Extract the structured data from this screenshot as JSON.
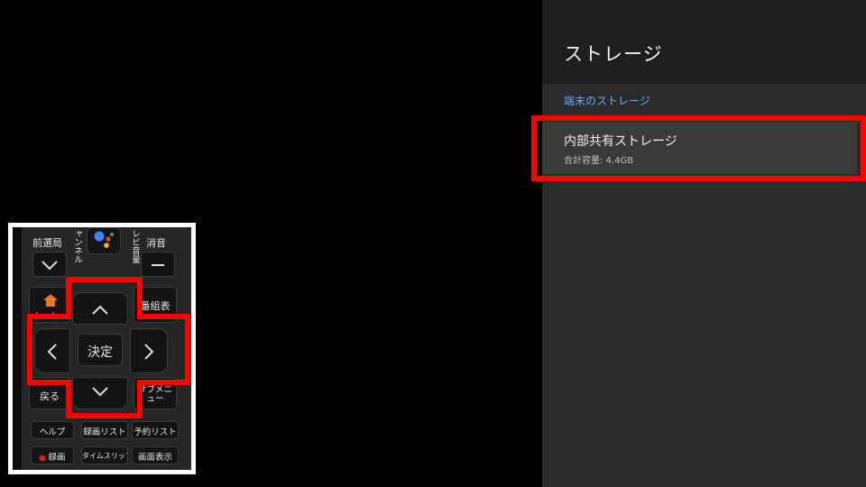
{
  "settings": {
    "title": "ストレージ",
    "section_label": "端末のストレージ",
    "items": [
      {
        "title": "内部共有ストレージ",
        "subtitle": "合計容量: 4.4GB"
      }
    ]
  },
  "highlight_color": "#ff0000",
  "remote": {
    "buttons": {
      "prev_station": "前選局",
      "mute": "消音",
      "channel_side": "ャンネル",
      "volume_side": "レビ音量",
      "tv_guide": "番組表",
      "home": "ホーム",
      "back": "戻る",
      "submenu": "サブメニュー",
      "ok": "決定",
      "help": "ヘルプ",
      "recordings": "録画リスト",
      "reservations": "予約リスト",
      "record": "録画",
      "timeslip": "タイムスリップ",
      "display": "画面表示"
    },
    "icons": {
      "assistant": "google-assistant-icon",
      "home": "home-icon",
      "up": "chevron-up-icon",
      "down": "chevron-down-icon",
      "left": "chevron-left-icon",
      "right": "chevron-right-icon",
      "record_dot": "record-dot-icon"
    },
    "colors": {
      "assistant_blue": "#4285f4",
      "assistant_red": "#ea4335",
      "assistant_yellow": "#fbbc05",
      "assistant_green": "#34a853",
      "home_orange": "#e8782a",
      "record_red": "#d42020"
    }
  }
}
